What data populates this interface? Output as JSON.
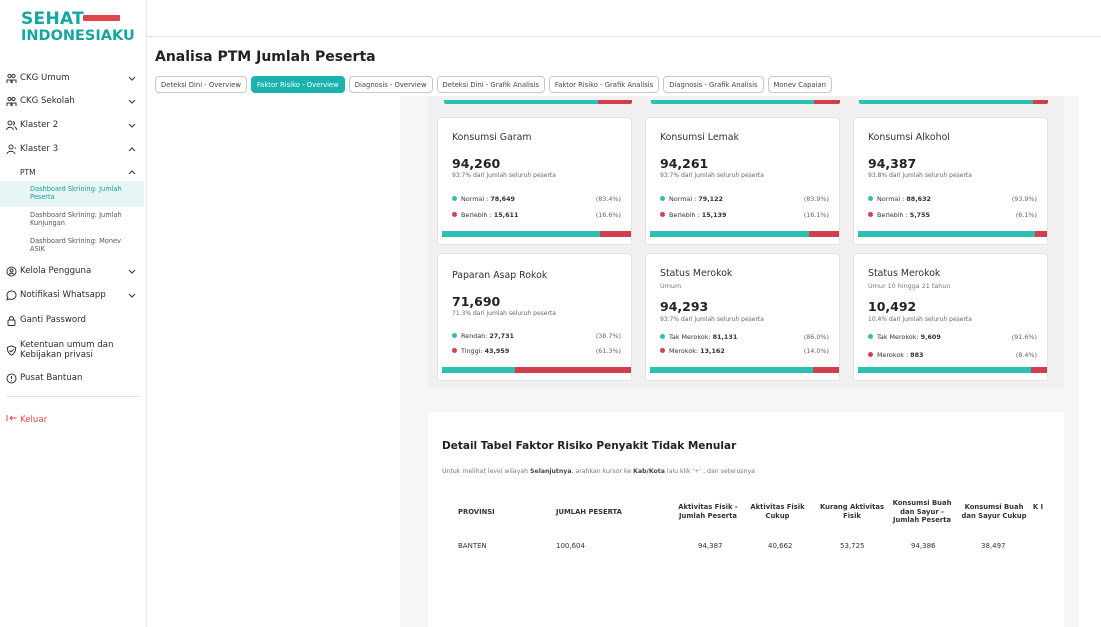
{
  "logo": {
    "top": "SEHAT",
    "bottom": "INDONESIAKU"
  },
  "sidebar": {
    "items": [
      {
        "label": "CKG Umum",
        "icon": "people-icon",
        "chev": "⌄"
      },
      {
        "label": "CKG Sekolah",
        "icon": "people-icon",
        "chev": "⌄"
      },
      {
        "label": "Klaster 2",
        "icon": "group-icon",
        "chev": "⌄"
      },
      {
        "label": "Klaster 3",
        "icon": "person-icon",
        "chev": "⌃"
      }
    ],
    "ptm_label": "PTM",
    "sub_items": [
      "Dashboard Skrining: Jumlah Peserta",
      "Dashboard Skrining: Jumlah Kunjungan",
      "Dashboard Skrining: Monev ASIK"
    ],
    "bottom_items": [
      {
        "label": "Kelola Pengguna",
        "icon": "user-settings-icon"
      },
      {
        "label": "Notifikasi Whatsapp",
        "icon": "chat-icon"
      },
      {
        "label": "Ganti Password",
        "icon": "lock-icon"
      },
      {
        "label": "Ketentuan umum dan Kebijakan privasi",
        "icon": "shield-check-icon"
      },
      {
        "label": "Pusat Bantuan",
        "icon": "info-icon"
      }
    ],
    "logout": "Keluar"
  },
  "page_title": "Analisa PTM Jumlah Peserta",
  "tabs": [
    "Deteksi Dini - Overview",
    "Faktor Risiko - Overview",
    "Diagnosis - Overview",
    "Deteksi Dini - Grafik Analisis",
    "Faktor Risiko - Grafik Analisis",
    "Diagnosis - Grafik Analisis",
    "Monev Capaian"
  ],
  "active_tab": 1,
  "colors": {
    "teal": "#2ebfb4",
    "red": "#d13f4f",
    "brand": "#14a6a0"
  },
  "cards": [
    {
      "title": "Konsumsi Garam",
      "subtitle": "",
      "value": "94,260",
      "pct_text": "93.7% dari jumlah seluruh peserta",
      "rows": [
        {
          "label": "Normal : ",
          "value": "78,649",
          "pct": "(83.4%)",
          "color": "teal"
        },
        {
          "label": "Berlebih : ",
          "value": "15,611",
          "pct": "(16.6%)",
          "color": "red"
        }
      ],
      "bar_teal": 83.4
    },
    {
      "title": "Konsumsi Lemak",
      "subtitle": "",
      "value": "94,261",
      "pct_text": "93.7% dari jumlah seluruh peserta",
      "rows": [
        {
          "label": "Normal : ",
          "value": "79,122",
          "pct": "(83.9%)",
          "color": "teal"
        },
        {
          "label": "Berlebih : ",
          "value": "15,139",
          "pct": "(16.1%)",
          "color": "red"
        }
      ],
      "bar_teal": 83.9
    },
    {
      "title": "Konsumsi Alkohol",
      "subtitle": "",
      "value": "94,387",
      "pct_text": "93.8% dari jumlah seluruh peserta",
      "rows": [
        {
          "label": "Normal : ",
          "value": "88,632",
          "pct": "(93.9%)",
          "color": "teal"
        },
        {
          "label": "Berlebih : ",
          "value": "5,755",
          "pct": "(6.1%)",
          "color": "red"
        }
      ],
      "bar_teal": 93.9
    },
    {
      "title": "Paparan Asap Rokok",
      "subtitle": "",
      "value": "71,690",
      "pct_text": "71.3% dari jumlah seluruh peserta",
      "rows": [
        {
          "label": "Rendah: ",
          "value": "27,731",
          "pct": "(38.7%)",
          "color": "teal"
        },
        {
          "label": "Tinggi: ",
          "value": "43,959",
          "pct": "(61.3%)",
          "color": "red"
        }
      ],
      "bar_teal": 38.7
    },
    {
      "title": "Status Merokok",
      "subtitle": "Umum",
      "value": "94,293",
      "pct_text": "93.7% dari jumlah seluruh peserta",
      "rows": [
        {
          "label": "Tak Merokok: ",
          "value": "81,131",
          "pct": "(86.0%)",
          "color": "teal"
        },
        {
          "label": "Merokok: ",
          "value": "13,162",
          "pct": "(14.0%)",
          "color": "red"
        }
      ],
      "bar_teal": 86.0
    },
    {
      "title": "Status Merokok",
      "subtitle": "Umur 10 hingga 21 tahun",
      "value": "10,492",
      "pct_text": "10.4% dari jumlah seluruh peserta",
      "rows": [
        {
          "label": "Tak Merokok: ",
          "value": "9,609",
          "pct": "(91.6%)",
          "color": "teal"
        },
        {
          "label": "Merokok : ",
          "value": "883",
          "pct": "(8.4%)",
          "color": "red"
        }
      ],
      "bar_teal": 91.6
    }
  ],
  "prev_strips_teal": [
    82,
    86,
    92
  ],
  "table": {
    "title": "Detail Tabel Faktor Risiko Penyakit Tidak Menular",
    "note_pre": "Untuk melihat level wilayah ",
    "note_bold1": "Selanjutnya",
    "note_mid": ", arahkan kursor ke ",
    "note_bold2": "Kab/Kota",
    "note_post": " lalu klik '+' , dan seterusnya",
    "headers": [
      "PROVINSI",
      "JUMLAH PESERTA",
      "Aktivitas Fisik - Jumlah Peserta",
      "Aktivitas Fisik Cukup",
      "Kurang Aktivitas Fisik",
      "Konsumsi Buah dan Sayur - Jumlah Peserta",
      "Konsumsi Buah dan Sayur Cukup",
      "K I"
    ],
    "rows": [
      [
        "BANTEN",
        "100,604",
        "94,387",
        "40,662",
        "53,725",
        "94,386",
        "38,497",
        ""
      ]
    ]
  }
}
